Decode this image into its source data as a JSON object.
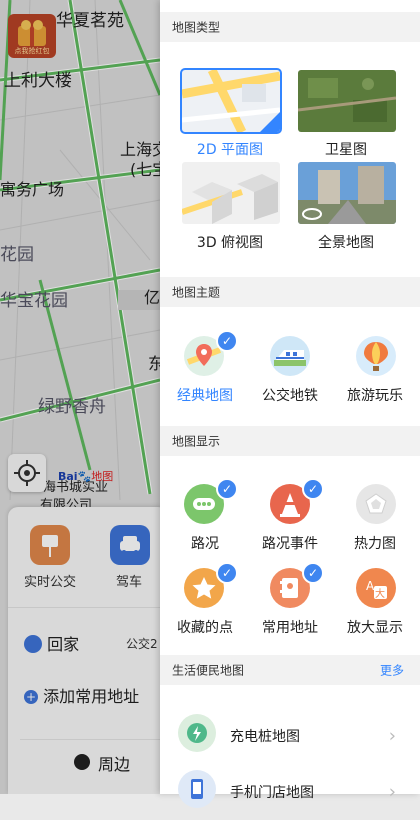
{
  "map": {
    "labels": {
      "huaxia": "华夏茗苑",
      "shangli": "上利大楼",
      "shanghai": "上海交",
      "qibao": "(七宝",
      "square": "寓务广场",
      "garden1": "花园",
      "garden2": "华宝花园",
      "yi": "亿",
      "dong": "东",
      "lvye": "绿野香舟",
      "company": "上海书城实业",
      "company2": "有限公司"
    },
    "promo_text": "点我抢红包",
    "baidu_logo": "Bai",
    "baidu_logo2": "地图",
    "card": {
      "quick_actions": [
        {
          "label": "实时公交",
          "icon": "bus-stop-icon",
          "color": "#e0874a"
        },
        {
          "label": "驾车",
          "icon": "car-icon",
          "color": "#3e74d8"
        }
      ],
      "home_label": "回家",
      "home_transit": "公交2",
      "add_address": "添加常用地址",
      "nearby": "周边"
    }
  },
  "panel": {
    "map_type": {
      "header": "地图类型",
      "items": [
        {
          "label": "2D 平面图",
          "selected": true
        },
        {
          "label": "卫星图",
          "selected": false
        },
        {
          "label": "3D 俯视图",
          "selected": false
        },
        {
          "label": "全景地图",
          "selected": false
        }
      ]
    },
    "map_theme": {
      "header": "地图主题",
      "items": [
        {
          "label": "经典地图",
          "selected": true,
          "icon": "classic-map-icon"
        },
        {
          "label": "公交地铁",
          "selected": false,
          "icon": "subway-train-icon"
        },
        {
          "label": "旅游玩乐",
          "selected": false,
          "icon": "hot-air-balloon-icon"
        }
      ]
    },
    "map_display": {
      "header": "地图显示",
      "items": [
        {
          "label": "路况",
          "selected": true,
          "icon": "traffic-icon",
          "color": "#7cc66b"
        },
        {
          "label": "路况事件",
          "selected": true,
          "icon": "traffic-cone-icon",
          "color": "#e8664d"
        },
        {
          "label": "热力图",
          "selected": false,
          "icon": "heatmap-pentagon-icon",
          "color": "#e6e6e6"
        },
        {
          "label": "收藏的点",
          "selected": true,
          "icon": "star-icon",
          "color": "#f2a64a"
        },
        {
          "label": "常用地址",
          "selected": true,
          "icon": "address-book-icon",
          "color": "#f08a60"
        },
        {
          "label": "放大显示",
          "selected": false,
          "icon": "enlarge-text-icon",
          "color": "#f0874e"
        }
      ]
    },
    "life_map": {
      "header": "生活便民地图",
      "more": "更多",
      "items": [
        {
          "label": "充电桩地图",
          "icon": "charging-pile-icon"
        },
        {
          "label": "手机门店地图",
          "icon": "phone-store-icon"
        }
      ]
    }
  }
}
